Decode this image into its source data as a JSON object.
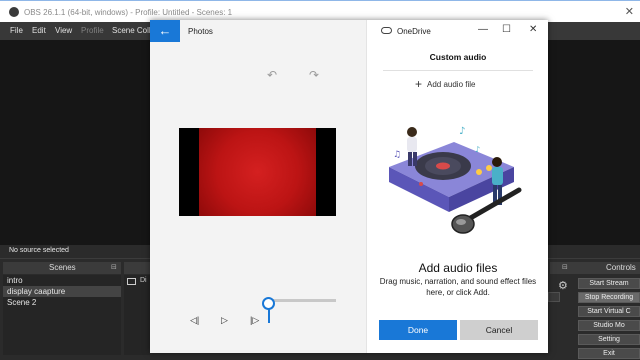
{
  "obs": {
    "title": "OBS 26.1.1 (64-bit, windows) - Profile: Untitled - Scenes: 1",
    "menu": [
      "File",
      "Edit",
      "View",
      "Profile",
      "Scene Colle"
    ],
    "status": "No source selected",
    "scenes_header": "Scenes",
    "scenes": [
      "intro",
      "display caapture",
      "Scene 2"
    ],
    "selected_scene": "display caapture",
    "sources_partial": "Di",
    "controls_header": "Controls",
    "controls": [
      "Start Stream",
      "Stop Recording",
      "Start Virtual C",
      "Studio Mo",
      "Setting",
      "Exit"
    ]
  },
  "photos": {
    "app_name": "Photos",
    "back_icon": "arrow-left-icon",
    "undo_icon": "undo-icon",
    "redo_icon": "redo-icon"
  },
  "onedrive": {
    "title": "OneDrive",
    "panel_title": "Custom audio",
    "add_audio_label": "Add audio file",
    "heading": "Add audio files",
    "description": "Drag music, narration, and sound effect files here, or click Add.",
    "done_label": "Done",
    "cancel_label": "Cancel"
  },
  "colors": {
    "accent": "#1978d7",
    "video": "#c81818"
  }
}
